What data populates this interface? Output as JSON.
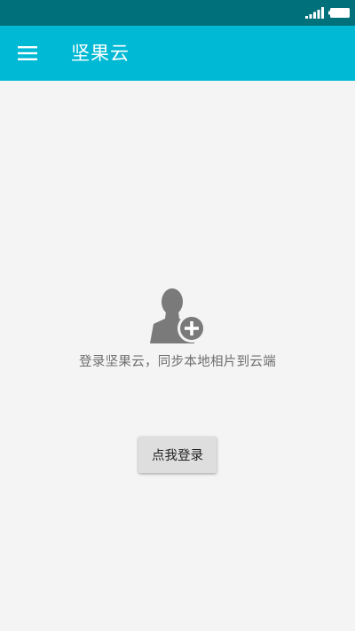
{
  "app": {
    "title": "坚果云"
  },
  "status_bar": {
    "icons": [
      "signal-icon",
      "battery-icon"
    ]
  },
  "app_bar": {
    "menu_icon": "menu-icon",
    "color": "#00b9d4"
  },
  "main": {
    "avatar_icon": "user-add-icon",
    "prompt": "登录坚果云，同步本地相片到云端",
    "login_button_label": "点我登录"
  },
  "colors": {
    "status_bar": "#00707a",
    "accent": "#00b9d4",
    "background": "#f4f4f4"
  }
}
